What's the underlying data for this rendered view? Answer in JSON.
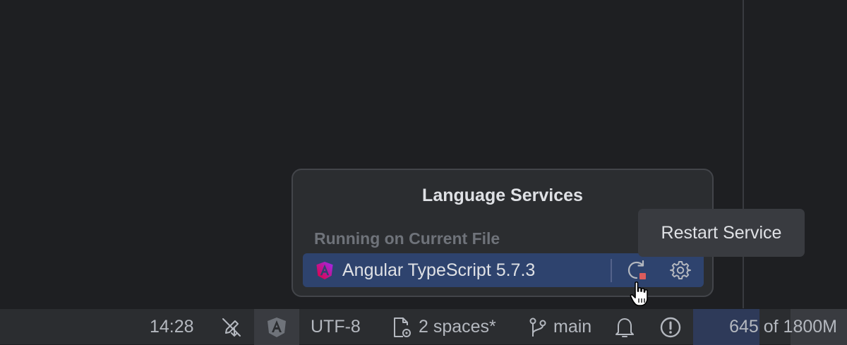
{
  "statusbar": {
    "caret_position": "14:28",
    "no_vcs_icon": "pencil-crossed-icon",
    "language_service_icon": "angular-icon",
    "encoding": "UTF-8",
    "indent": "2 spaces*",
    "indent_icon": "file-settings-icon",
    "branch": "main",
    "branch_icon": "git-branch-icon",
    "notifications_icon": "bell-icon",
    "problems_icon": "exclamation-circle-icon",
    "memory": {
      "text": "645 of 1800M",
      "used_mb": 645,
      "total_mb": 1800
    }
  },
  "popup": {
    "title": "Language Services",
    "section": "Running on Current File",
    "service": {
      "name": "Angular TypeScript 5.7.3",
      "icon": "angular-icon",
      "restart_icon": "restart-icon",
      "settings_icon": "gear-icon"
    }
  },
  "tooltip": {
    "text": "Restart Service"
  },
  "colors": {
    "editor_bg": "#1e1f22",
    "statusbar_bg": "#2b2d30",
    "selection": "#2e436e",
    "angular_gradient_start": "#e40035",
    "angular_gradient_end": "#9d2af3",
    "stop_red": "#db5c5c"
  }
}
